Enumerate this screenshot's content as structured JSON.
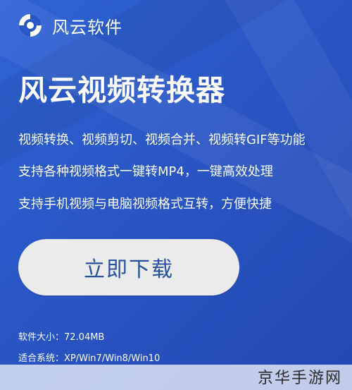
{
  "brand": {
    "name": "风云软件",
    "logo_icon": "circle-logo-icon"
  },
  "hero": {
    "headline": "风云视频转换器",
    "features": [
      "视频转换、视频剪切、视频合并、视频转GIF等功能",
      "支持各种视频格式一键转MP4，一键高效处理",
      "支持手机视频与电脑视频格式互转，方便快捷"
    ]
  },
  "download": {
    "button_label": "立即下载"
  },
  "meta": {
    "size": "软件大小：72.04MB",
    "system": "适合系统：XP/Win7/Win8/Win10"
  },
  "watermark": "京华手游网",
  "colors": {
    "background": "#2a55c4",
    "button_bg": "#ebebeb",
    "button_text": "#2a4f9e"
  }
}
